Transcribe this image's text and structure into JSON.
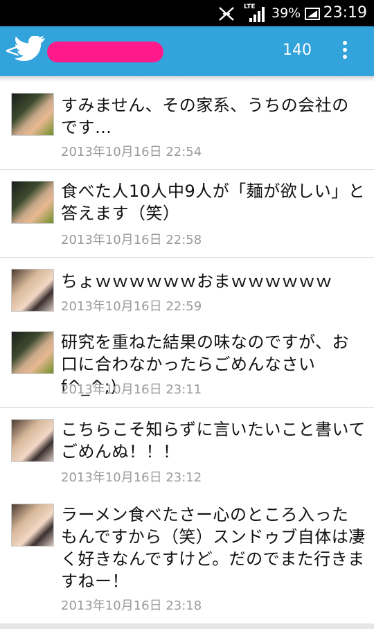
{
  "status_bar": {
    "network": "LTE",
    "battery": "39%",
    "clock": "23:19"
  },
  "app_bar": {
    "back_glyph": "<",
    "count": "140"
  },
  "tweets": [
    {
      "avatar": "boy",
      "text": "すみません、その家系、うちの会社のです…",
      "time": "2013年10月16日 22:54"
    },
    {
      "avatar": "boy",
      "text": "食べた人10人中9人が「麺が欲しい」と答えます（笑）",
      "time": "2013年10月16日 22:58"
    },
    {
      "avatar": "girl",
      "text": "ちょｗｗｗｗｗｗおまｗｗｗｗｗｗ",
      "time": "2013年10月16日 22:59"
    },
    {
      "avatar": "boy",
      "text": "研究を重ねた結果の味なのですが、お口に合わなかったらごめんなさいf^_^;)",
      "time": "2013年10月16日 23:11"
    },
    {
      "avatar": "girl",
      "text": "こちらこそ知らずに言いたいこと書いてごめんぬ！！！",
      "time": "2013年10月16日 23:12"
    },
    {
      "avatar": "girl",
      "text": "ラーメン食べたさー心のところ入ったもんですから（笑）スンドゥブ自体は凄く好きなんですけど。だのでまた行きますねー！",
      "time": "2013年10月16日 23:18"
    }
  ]
}
